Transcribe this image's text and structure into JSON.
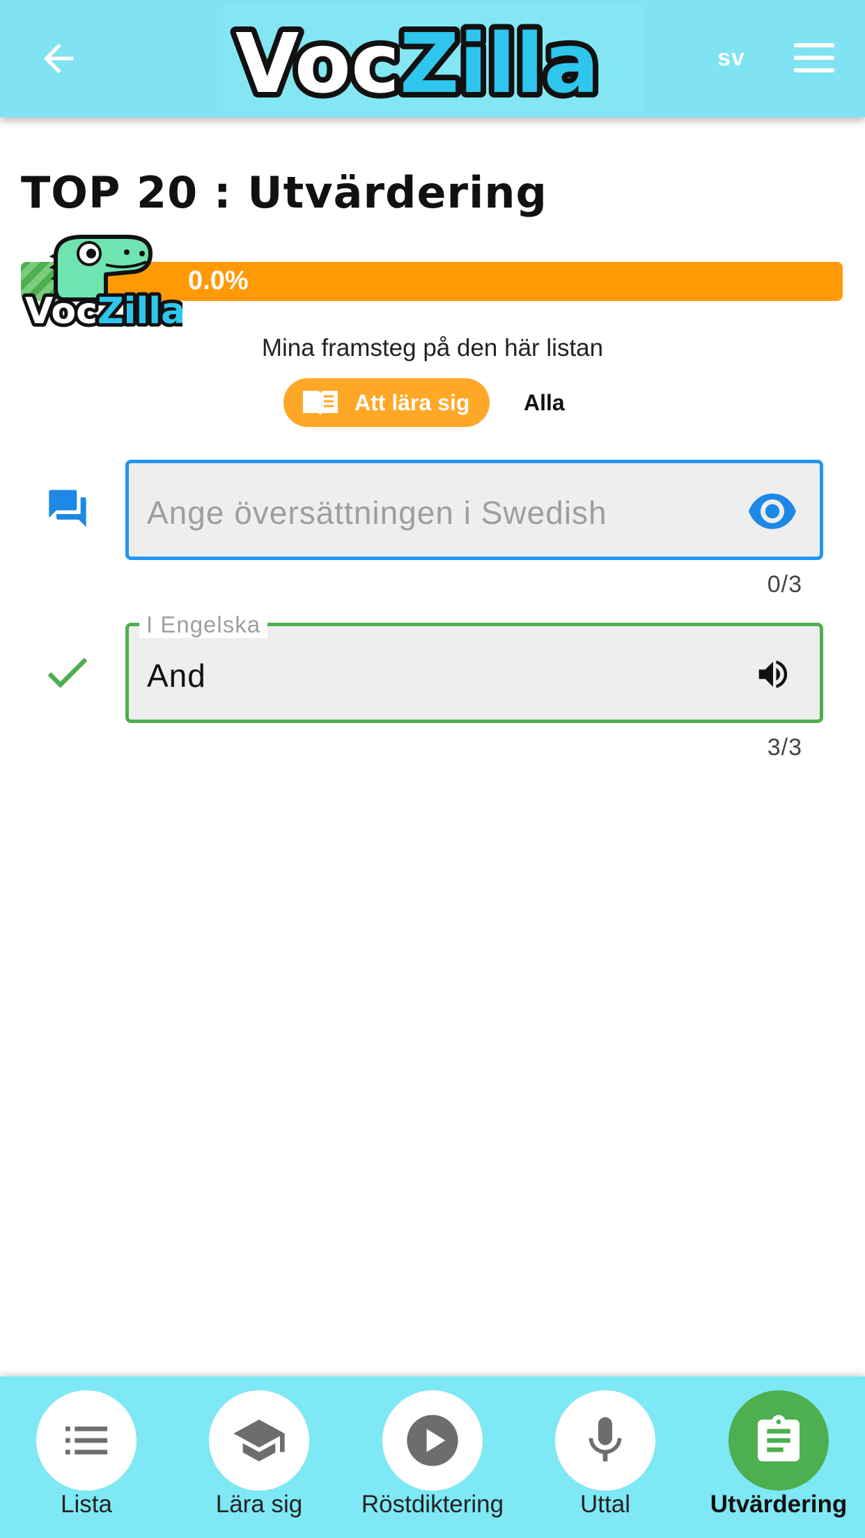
{
  "header": {
    "logo_text_part1": "Voc",
    "logo_text_part2": "Zilla",
    "language": "sv"
  },
  "page": {
    "title": "TOP 20 : Utvärdering"
  },
  "progress": {
    "label": "0.0%",
    "value_fraction": 0.0,
    "mascot_text_part1": "Voc",
    "mascot_text_part2": "Zilla"
  },
  "subtitle": "Mina framsteg på den här listan",
  "toggle": {
    "active_label": "Att lära sig",
    "other_label": "Alla"
  },
  "question_field": {
    "placeholder": "Ange översättningen i Swedish",
    "counter": "0/3"
  },
  "answer_field": {
    "label": "I Engelska",
    "value": "And",
    "counter": "3/3"
  },
  "nav": {
    "items": [
      {
        "label": "Lista",
        "icon": "list-icon"
      },
      {
        "label": "Lära sig",
        "icon": "school-icon"
      },
      {
        "label": "Röstdiktering",
        "icon": "play-icon"
      },
      {
        "label": "Uttal",
        "icon": "mic-icon"
      },
      {
        "label": "Utvärdering",
        "icon": "assignment-icon",
        "active": true
      }
    ]
  },
  "colors": {
    "header_bg": "#7fe3f1",
    "accent_orange": "#ff9a06",
    "accent_blue": "#2196f3",
    "accent_green": "#4caf50"
  }
}
